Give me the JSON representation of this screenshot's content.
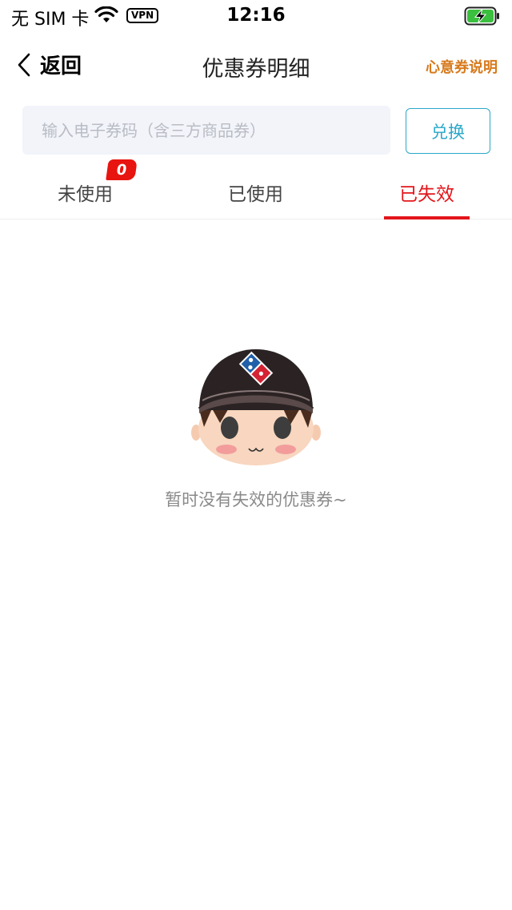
{
  "status_bar": {
    "carrier": "无 SIM 卡",
    "vpn": "VPN",
    "time": "12:16"
  },
  "nav": {
    "back_label": "返回",
    "title": "优惠券明细",
    "help_link": "心意券说明"
  },
  "redeem": {
    "placeholder": "输入电子券码（含三方商品券）",
    "value": "",
    "button_label": "兑换"
  },
  "tabs": [
    {
      "label": "未使用",
      "badge": "0",
      "active": false
    },
    {
      "label": "已使用",
      "active": false
    },
    {
      "label": "已失效",
      "active": true
    }
  ],
  "empty_state": {
    "message": "暂时没有失效的优惠券~"
  },
  "colors": {
    "accent_red": "#e3161b",
    "link_orange": "#d77a1c",
    "button_blue": "#2aa8c9",
    "input_bg": "#f2f4fa"
  }
}
